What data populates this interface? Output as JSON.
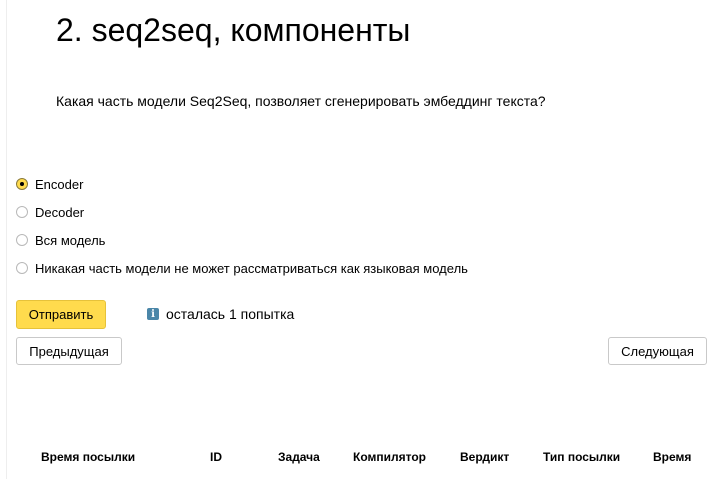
{
  "page": {
    "title": "2. seq2seq, компоненты",
    "question": "Какая часть модели Seq2Seq, позволяет сгенерировать эмбеддинг текста?"
  },
  "options": [
    {
      "label": "Encoder",
      "selected": true
    },
    {
      "label": "Decoder",
      "selected": false
    },
    {
      "label": "Вся модель",
      "selected": false
    },
    {
      "label": "Никакая часть модели не может рассматриваться как языковая модель",
      "selected": false
    }
  ],
  "actions": {
    "submit_label": "Отправить",
    "attempts_text": "осталась 1 попытка",
    "prev_label": "Предыдущая",
    "next_label": "Следующая"
  },
  "submissions_table": {
    "columns": [
      "Время посылки",
      "ID",
      "Задача",
      "Компилятор",
      "Вердикт",
      "Тип посылки",
      "Время"
    ]
  },
  "colors": {
    "accent": "#ffdb4d",
    "info_icon": "#4a86a8"
  },
  "icons": {
    "attempts": "info-icon"
  }
}
